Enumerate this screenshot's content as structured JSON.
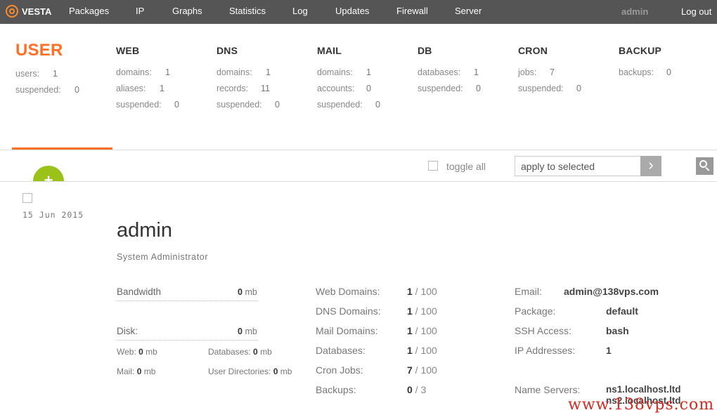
{
  "brand": {
    "name": "VESTA"
  },
  "nav": {
    "items": [
      "Packages",
      "IP",
      "Graphs",
      "Statistics",
      "Log",
      "Updates",
      "Firewall",
      "Server"
    ],
    "user": "admin",
    "logout": "Log out"
  },
  "stats": {
    "user": {
      "title": "USER",
      "rows": [
        [
          "users:",
          "1"
        ],
        [
          "suspended:",
          "0"
        ]
      ]
    },
    "web": {
      "title": "WEB",
      "rows": [
        [
          "domains:",
          "1"
        ],
        [
          "aliases:",
          "1"
        ],
        [
          "suspended:",
          "0"
        ]
      ]
    },
    "dns": {
      "title": "DNS",
      "rows": [
        [
          "domains:",
          "1"
        ],
        [
          "records:",
          "11"
        ],
        [
          "suspended:",
          "0"
        ]
      ]
    },
    "mail": {
      "title": "MAIL",
      "rows": [
        [
          "domains:",
          "1"
        ],
        [
          "accounts:",
          "0"
        ],
        [
          "suspended:",
          "0"
        ]
      ]
    },
    "db": {
      "title": "DB",
      "rows": [
        [
          "databases:",
          "1"
        ],
        [
          "suspended:",
          "0"
        ]
      ]
    },
    "cron": {
      "title": "CRON",
      "rows": [
        [
          "jobs:",
          "7"
        ],
        [
          "suspended:",
          "0"
        ]
      ]
    },
    "backup": {
      "title": "BACKUP",
      "rows": [
        [
          "backups:",
          "0"
        ]
      ]
    }
  },
  "toolbar": {
    "add_label": "+",
    "toggle_all": "toggle all",
    "apply_value": "apply to selected",
    "go_label": "›"
  },
  "user_row": {
    "date": "15  Jun  2015",
    "name": "admin",
    "role": "System Administrator",
    "bandwidth": {
      "label": "Bandwidth",
      "value": "0",
      "unit": "mb"
    },
    "disk": {
      "label": "Disk:",
      "value": "0",
      "unit": "mb"
    },
    "disk_parts": [
      {
        "label": "Web:",
        "value": "0",
        "unit": "mb"
      },
      {
        "label": "Databases:",
        "value": "0",
        "unit": "mb"
      },
      {
        "label": "Mail:",
        "value": "0",
        "unit": "mb"
      },
      {
        "label": "User Directories:",
        "value": "0",
        "unit": "mb"
      }
    ],
    "limits": [
      {
        "label": "Web Domains:",
        "used": "1",
        "max": "100"
      },
      {
        "label": "DNS Domains:",
        "used": "1",
        "max": "100"
      },
      {
        "label": "Mail Domains:",
        "used": "1",
        "max": "100"
      },
      {
        "label": "Databases:",
        "used": "1",
        "max": "100"
      },
      {
        "label": "Cron Jobs:",
        "used": "7",
        "max": "100"
      },
      {
        "label": "Backups:",
        "used": "0",
        "max": "3"
      }
    ],
    "details": [
      {
        "label": "Email:",
        "value": "admin@138vps.com"
      },
      {
        "label": "Package:",
        "value": "default"
      },
      {
        "label": "SSH Access:",
        "value": "bash"
      },
      {
        "label": "IP Addresses:",
        "value": "1"
      }
    ],
    "name_servers": {
      "label": "Name Servers:",
      "values": [
        "ns1.localhost.ltd",
        "ns2.localhost.ltd"
      ]
    }
  },
  "watermark": "www.138vps.com",
  "colors": {
    "topbar": "#555555",
    "accent": "#ff6f26",
    "add_button": "#9ac219"
  }
}
